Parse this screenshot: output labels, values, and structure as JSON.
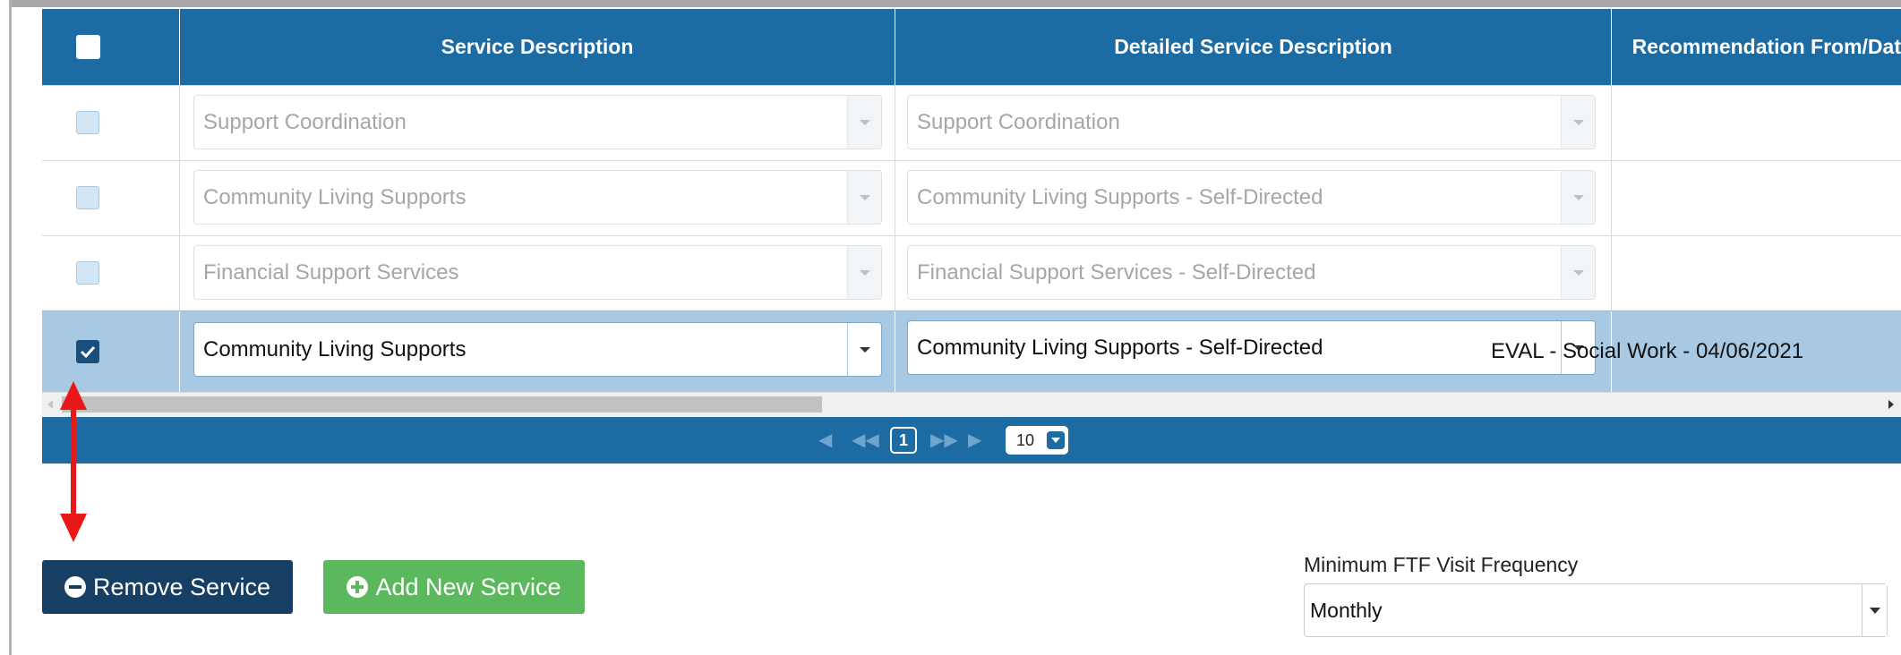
{
  "colors": {
    "header_bg": "#1c6ba2",
    "selected_row_bg": "#a8c9e3",
    "remove_button_bg": "#173e63",
    "add_button_bg": "#5cb85c",
    "annotation_arrow": "#e81818"
  },
  "table": {
    "columns": [
      "Service Description",
      "Detailed Service Description",
      "Recommendation From/Dat"
    ],
    "rows": [
      {
        "checked": false,
        "service": "Support Coordination",
        "detail": "Support Coordination",
        "recommendation": ""
      },
      {
        "checked": false,
        "service": "Community Living Supports",
        "detail": "Community Living Supports - Self-Directed",
        "recommendation": ""
      },
      {
        "checked": false,
        "service": "Financial Support Services",
        "detail": "Financial Support Services - Self-Directed",
        "recommendation": ""
      },
      {
        "checked": true,
        "service": "Community Living Supports",
        "detail": "Community Living Supports - Self-Directed",
        "recommendation": "EVAL - Social Work - 04/06/2021"
      }
    ]
  },
  "pager": {
    "icons": [
      "first-page-icon",
      "previous-page-icon",
      "next-page-icon",
      "last-page-icon"
    ],
    "current_page": "1",
    "page_size": "10"
  },
  "buttons": {
    "remove": "Remove Service",
    "add": "Add New Service"
  },
  "ftf": {
    "label": "Minimum FTF Visit Frequency",
    "value": "Monthly"
  }
}
